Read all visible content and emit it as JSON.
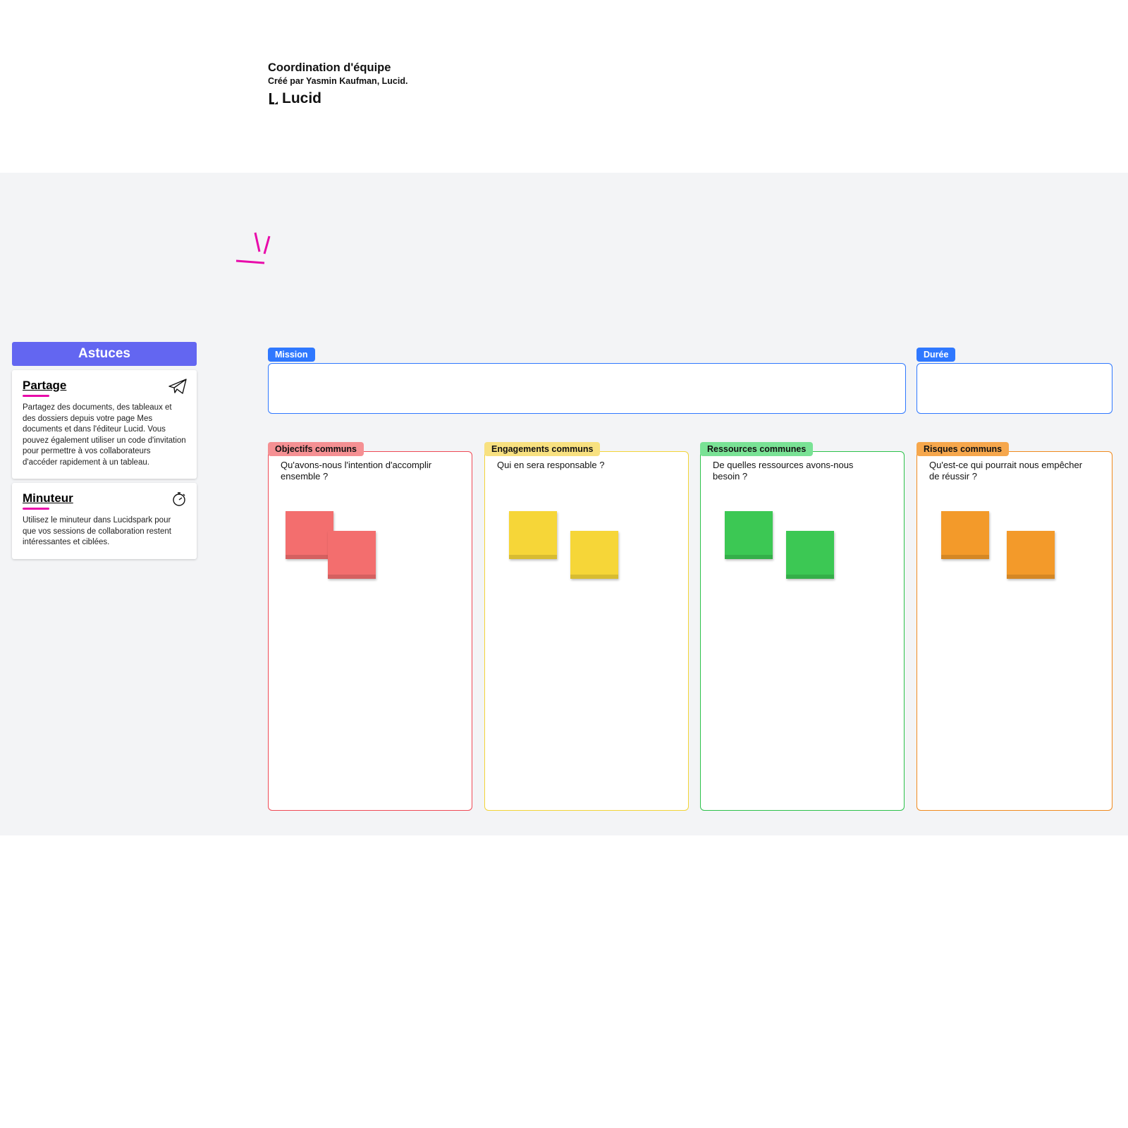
{
  "header": {
    "title": "Coordination d'équipe",
    "subtitle_prefix": "Créé par Yasmin Kaufman, L",
    "subtitle_bold": "ucid.",
    "logo_text": "Lucid"
  },
  "sidebar": {
    "header": "Astuces",
    "tips": [
      {
        "title": "Partage",
        "accent": "#e80baa",
        "icon": "paper-plane",
        "body": "Partagez des documents, des tableaux et des dossiers depuis votre page Mes documents et dans l'éditeur Lucid. Vous pouvez également utiliser un code d'invitation pour permettre à vos collaborateurs d'accéder rapidement à un tableau."
      },
      {
        "title": "Minuteur",
        "accent": "#e80baa",
        "icon": "stopwatch",
        "body": "Utilisez le minuteur dans Lucidspark pour que vos sessions de collaboration restent intéressantes et ciblées."
      }
    ]
  },
  "banners": {
    "mission": {
      "label": "Mission",
      "color": "#2f78ff"
    },
    "duration": {
      "label": "Durée",
      "color": "#2f78ff"
    }
  },
  "columns": [
    {
      "id": "objectives",
      "label": "Objectifs communs",
      "color": "#ef4a55",
      "tag_bg": "#f59093",
      "prompt": "Qu'avons-nous l'intention d'accomplir ensemble ?",
      "sticky": "#f36e6e"
    },
    {
      "id": "commitments",
      "label": "Engagements communs",
      "color": "#f2d437",
      "tag_bg": "#f8e180",
      "prompt": "Qui en sera responsable ?",
      "sticky": "#f6d638"
    },
    {
      "id": "resources",
      "label": "Ressources communes",
      "color": "#2cc24a",
      "tag_bg": "#79e295",
      "prompt": "De quelles ressources avons-nous besoin ?",
      "sticky": "#3cc854"
    },
    {
      "id": "risks",
      "label": "Risques communs",
      "color": "#f08a1e",
      "tag_bg": "#f6a74c",
      "prompt": "Qu'est-ce qui pourrait nous empêcher de réussir ?",
      "sticky": "#f39a2a"
    }
  ]
}
